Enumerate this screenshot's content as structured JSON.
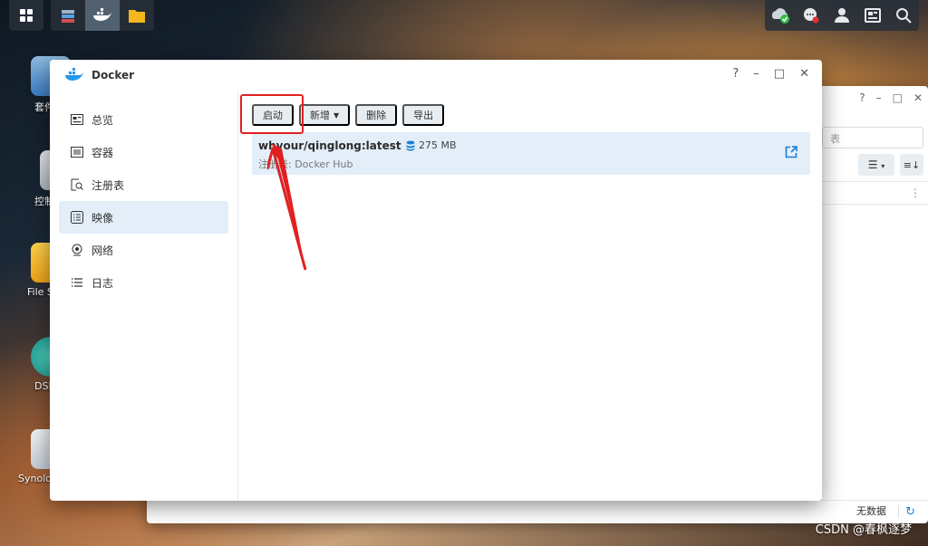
{
  "desktop": {
    "icons": [
      {
        "label": "套件"
      },
      {
        "label": "控制"
      },
      {
        "label": "File S"
      },
      {
        "label": "DSM"
      },
      {
        "label": "Synolo"
      }
    ]
  },
  "background_window": {
    "search_placeholder": "表",
    "footer_status": "无数据"
  },
  "window": {
    "title": "Docker",
    "controls": {
      "help": "?",
      "minimize": "–",
      "maximize": "□",
      "close": "✕"
    }
  },
  "sidebar": {
    "items": [
      {
        "label": "总览",
        "icon": "overview-icon"
      },
      {
        "label": "容器",
        "icon": "container-icon"
      },
      {
        "label": "注册表",
        "icon": "registry-icon"
      },
      {
        "label": "映像",
        "icon": "image-icon",
        "active": true
      },
      {
        "label": "网络",
        "icon": "network-icon"
      },
      {
        "label": "日志",
        "icon": "log-icon"
      }
    ]
  },
  "toolbar": {
    "launch_label": "启动",
    "add_label": "新增",
    "delete_label": "删除",
    "export_label": "导出"
  },
  "images": [
    {
      "name": "whyour/qinglong:latest",
      "size": "275 MB",
      "registry": "注册表: Docker Hub"
    }
  ],
  "watermark": "CSDN @春枫逐梦",
  "colors": {
    "accent": "#1a7fd4",
    "selected_bg": "#e3eef9",
    "annotation": "#e02020"
  }
}
